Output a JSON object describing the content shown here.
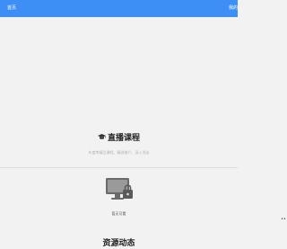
{
  "topbar": {
    "home_label": "首页",
    "right_label": "我的"
  },
  "hero": {
    "title": "直播课程",
    "subtitle": "年度考精品课程，精选推介，深入浅出"
  },
  "empty_state": {
    "label": "暂无可看"
  },
  "side_indicator": "••",
  "next_section": {
    "title": "资源动态"
  },
  "colors": {
    "accent": "#3d8ef5",
    "background": "#f2f2f2"
  },
  "icons": {
    "hero": "graduation-cap-icon",
    "empty": "locked-monitor-icon"
  }
}
